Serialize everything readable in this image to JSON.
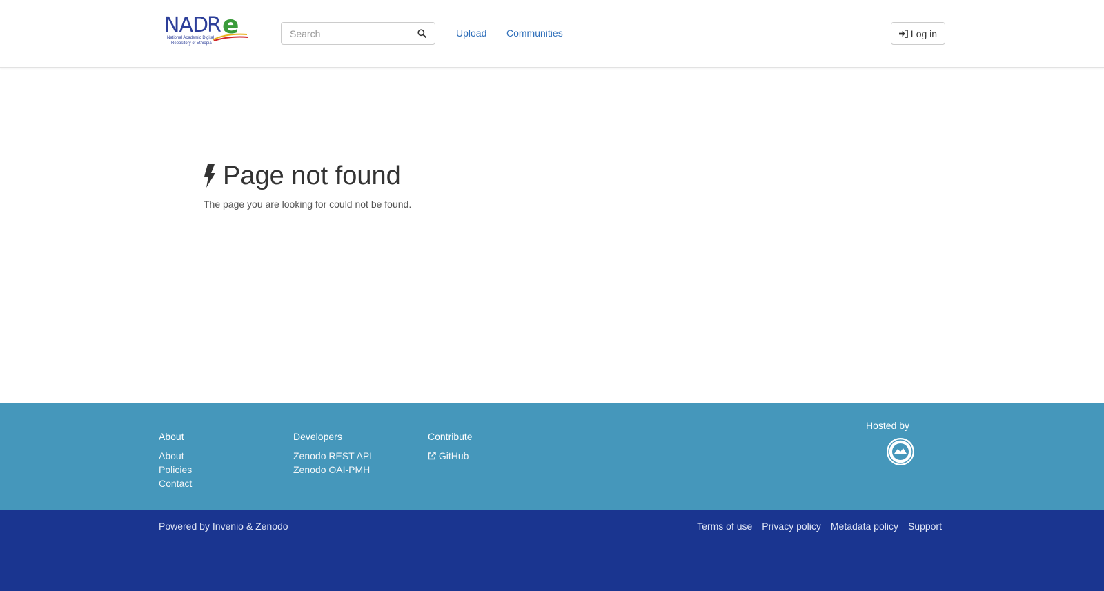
{
  "header": {
    "logo": {
      "text": "NADRe",
      "subtitle_line1": "National Academic Digital",
      "subtitle_line2": "Repository of Ethiopia"
    },
    "search": {
      "placeholder": "Search",
      "value": ""
    },
    "nav": [
      "Upload",
      "Communities"
    ],
    "login_label": "Log in"
  },
  "main": {
    "title": "Page not found",
    "message": "The page you are looking for could not be found."
  },
  "footer": {
    "columns": [
      {
        "heading": "About",
        "items": [
          "About",
          "Policies",
          "Contact"
        ]
      },
      {
        "heading": "Developers",
        "items": [
          "Zenodo REST API",
          "Zenodo OAI-PMH"
        ]
      },
      {
        "heading": "Contribute",
        "items": [
          "GitHub"
        ]
      }
    ],
    "hosted_by": "Hosted by",
    "powered_prefix": "Powered by",
    "powered_invenio": "Invenio",
    "powered_amp": "&",
    "powered_zenodo": "Zenodo",
    "bottom_links": [
      "Terms of use",
      "Privacy policy",
      "Metadata policy",
      "Support"
    ]
  },
  "colors": {
    "link": "#2f6fba",
    "footer_top": "#4597bb",
    "footer_bottom": "#1a3590"
  },
  "icons": {
    "search_button": "search-icon",
    "login": "sign-in-icon",
    "error": "bolt-icon",
    "github": "external-link-icon",
    "host_logo": "university-seal-icon"
  }
}
